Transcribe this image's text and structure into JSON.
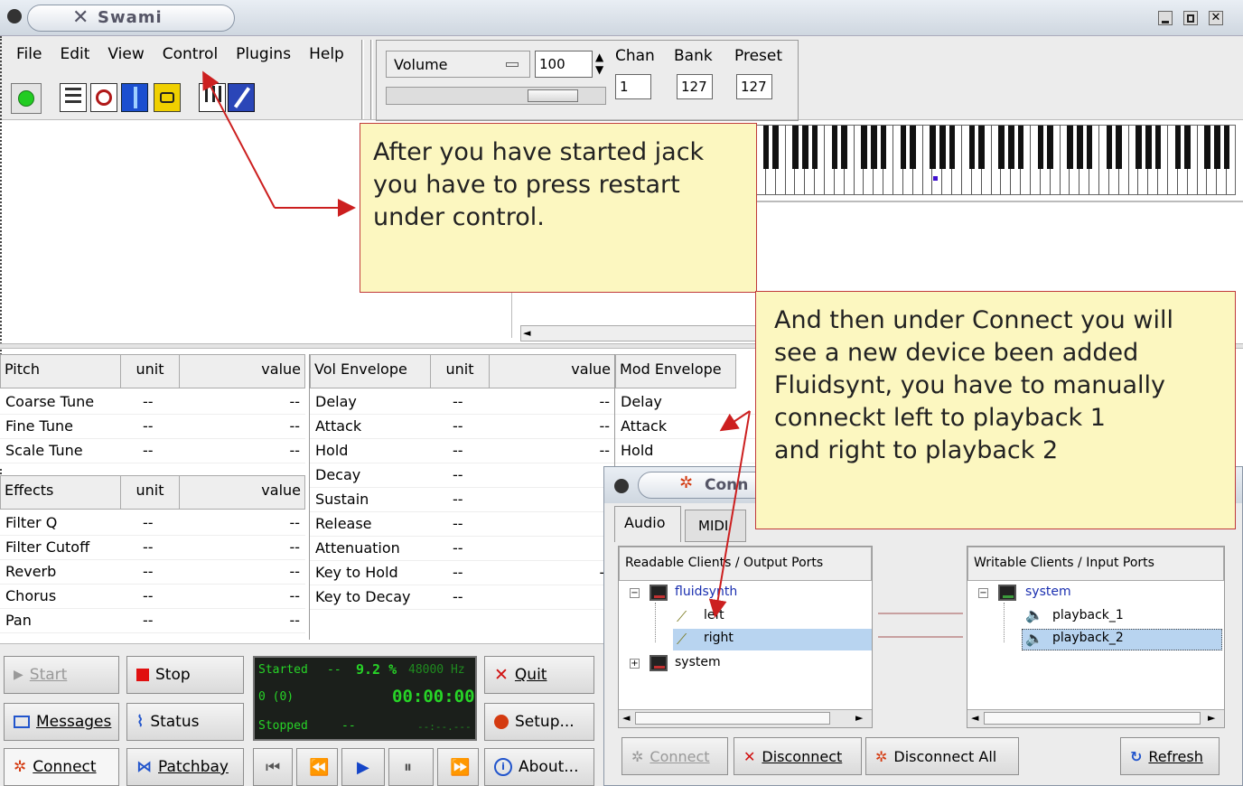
{
  "window": {
    "title": "Swami",
    "controls": [
      "minimize-icon",
      "maximize-icon",
      "close-icon"
    ]
  },
  "menubar": [
    "File",
    "Edit",
    "View",
    "Control",
    "Plugins",
    "Help"
  ],
  "toolbar": {
    "icons": [
      "green-led-icon",
      "sample-editor-icon",
      "mod-icon",
      "wave-icon",
      "loop-icon",
      "keyboard-icon",
      "edit-icon"
    ],
    "volume": {
      "label": "Volume",
      "value": "100"
    },
    "chan": {
      "label": "Chan",
      "value": "1"
    },
    "bank": {
      "label": "Bank",
      "value": "127"
    },
    "preset": {
      "label": "Preset",
      "value": "127"
    }
  },
  "piano": {
    "octaves": 7
  },
  "notes": {
    "note1": "After you have started jack\nyou have to press restart\nunder control.",
    "note2": "And then under Connect you will\nsee a new device been added\nFluidsynt, you have to manually\nconneckt left to playback 1\nand right to playback 2"
  },
  "gen_table1": {
    "headers": [
      "Pitch",
      "unit",
      "value"
    ],
    "rows": [
      [
        "Coarse Tune",
        "--",
        "--"
      ],
      [
        "Fine Tune",
        "--",
        "--"
      ],
      [
        "Scale Tune",
        "--",
        "--"
      ]
    ]
  },
  "gen_table2": {
    "headers": [
      "Effects",
      "unit",
      "value"
    ],
    "rows": [
      [
        "Filter Q",
        "--",
        "--"
      ],
      [
        "Filter Cutoff",
        "--",
        "--"
      ],
      [
        "Reverb",
        "--",
        "--"
      ],
      [
        "Chorus",
        "--",
        "--"
      ],
      [
        "Pan",
        "--",
        "--"
      ]
    ]
  },
  "vol_env": {
    "headers": [
      "Vol Envelope",
      "unit",
      "value"
    ],
    "rows": [
      [
        "Delay",
        "--",
        "--"
      ],
      [
        "Attack",
        "--",
        "--"
      ],
      [
        "Hold",
        "--",
        "--"
      ],
      [
        "Decay",
        "--",
        ""
      ],
      [
        "Sustain",
        "--",
        ""
      ],
      [
        "Release",
        "--",
        ""
      ],
      [
        "Attenuation",
        "--",
        ""
      ],
      [
        "Key to Hold",
        "--",
        "--"
      ],
      [
        "Key to Decay",
        "--",
        ""
      ]
    ]
  },
  "mod_env": {
    "headers": [
      "Mod Envelope"
    ],
    "rows": [
      [
        "Delay"
      ],
      [
        "Attack"
      ],
      [
        "Hold"
      ]
    ]
  },
  "qjack": {
    "start": "Start",
    "stop": "Stop",
    "quit": "Quit",
    "messages": "Messages",
    "status": "Status",
    "setup": "Setup...",
    "connect": "Connect",
    "patchbay": "Patchbay",
    "about": "About...",
    "display": {
      "state1": "Started",
      "sep": "--",
      "dsp": "9.2 %",
      "rate": "48000 Hz",
      "xruns": "0 (0)",
      "time": "00:00:00",
      "state2": "Stopped",
      "sep2": "--",
      "small": "--:--.---"
    }
  },
  "connections": {
    "title": "Conn",
    "tabs": [
      "Audio",
      "MIDI"
    ],
    "readable_header": "Readable Clients / Output Ports",
    "writable_header": "Writable Clients / Input Ports",
    "readable_tree": [
      {
        "label": "fluidsynth",
        "kind": "client"
      },
      {
        "label": "left",
        "kind": "port"
      },
      {
        "label": "right",
        "kind": "port"
      },
      {
        "label": "system",
        "kind": "client"
      }
    ],
    "writable_tree": [
      {
        "label": "system",
        "kind": "client"
      },
      {
        "label": "playback_1",
        "kind": "port"
      },
      {
        "label": "playback_2",
        "kind": "port"
      }
    ],
    "buttons": {
      "connect": "Connect",
      "disconnect": "Disconnect",
      "disconnect_all": "Disconnect All",
      "refresh": "Refresh"
    }
  },
  "colors": {
    "note_fill": "#fcf7c0",
    "note_border": "#c03a3a",
    "arrow": "#cc1f1f",
    "selection": "#b8d4f0",
    "lcd_bg": "#1b1f1b",
    "lcd_green": "#27d427"
  }
}
